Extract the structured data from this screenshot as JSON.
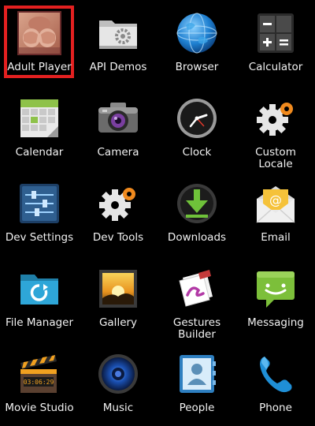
{
  "apps": [
    {
      "label": "Adult Player",
      "icon": "adult-player-icon"
    },
    {
      "label": "API Demos",
      "icon": "api-demos-folder-icon"
    },
    {
      "label": "Browser",
      "icon": "globe-icon"
    },
    {
      "label": "Calculator",
      "icon": "calculator-icon"
    },
    {
      "label": "Calendar",
      "icon": "calendar-icon"
    },
    {
      "label": "Camera",
      "icon": "camera-icon"
    },
    {
      "label": "Clock",
      "icon": "clock-icon"
    },
    {
      "label": "Custom\nLocale",
      "icon": "gear-icon"
    },
    {
      "label": "Dev Settings",
      "icon": "sliders-icon"
    },
    {
      "label": "Dev Tools",
      "icon": "gear-icon"
    },
    {
      "label": "Downloads",
      "icon": "download-icon"
    },
    {
      "label": "Email",
      "icon": "email-icon"
    },
    {
      "label": "File Manager",
      "icon": "folder-icon"
    },
    {
      "label": "Gallery",
      "icon": "gallery-icon"
    },
    {
      "label": "Gestures\nBuilder",
      "icon": "gestures-icon"
    },
    {
      "label": "Messaging",
      "icon": "messaging-icon"
    },
    {
      "label": "Movie Studio",
      "icon": "clapperboard-icon"
    },
    {
      "label": "Music",
      "icon": "speaker-icon"
    },
    {
      "label": "People",
      "icon": "contacts-icon"
    },
    {
      "label": "Phone",
      "icon": "phone-icon"
    }
  ],
  "clapper_time": "03:06:29",
  "highlight_color": "#e32020"
}
